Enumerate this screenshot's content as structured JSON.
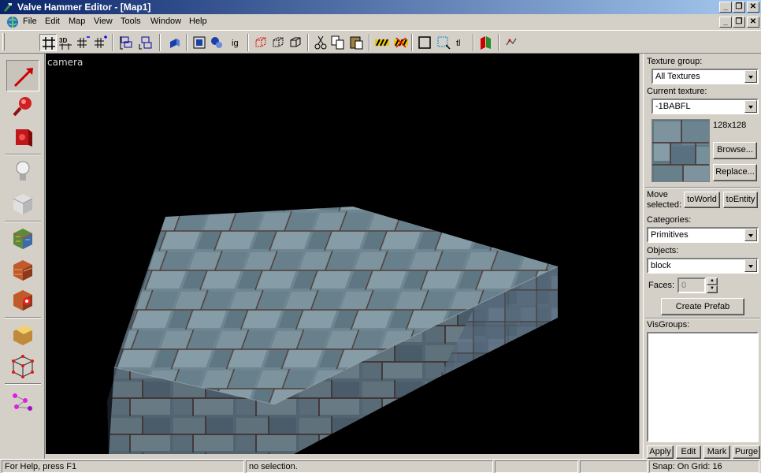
{
  "window": {
    "title": "Valve Hammer Editor - [Map1]"
  },
  "menu": {
    "items": [
      "File",
      "Edit",
      "Map",
      "View",
      "Tools",
      "Window",
      "Help"
    ]
  },
  "toolbar": {
    "buttons": [
      "grid-icon",
      "3d-grid-icon",
      "smaller-grid-icon",
      "larger-grid-icon",
      "group-icon",
      "ungroup-icon",
      "tie-to-entity-icon",
      "carve-icon",
      "hollow-icon",
      "texture-lock-icon",
      "ig-icon",
      "hide-selected-icon",
      "hide-unselected-icon",
      "show-all-icon",
      "cut-icon",
      "copy-icon",
      "paste-icon",
      "toggle-hidden-icon",
      "toggle-cordon-icon",
      "select-box-icon",
      "select-all-icon",
      "tl-icon",
      "run-map-icon",
      "options-icon"
    ],
    "ig_label": "ig",
    "tl_label": "tl"
  },
  "tools": [
    "selection-tool",
    "magnify-tool",
    "camera-tool",
    "entity-tool",
    "block-tool",
    "texture-application-tool",
    "apply-current-texture-tool",
    "decal-tool",
    "clipping-tool",
    "vertex-manipulation-tool",
    "path-tool"
  ],
  "viewport": {
    "label": "camera"
  },
  "right_panel": {
    "texture_group_label": "Texture group:",
    "texture_group_value": "All Textures",
    "current_texture_label": "Current texture:",
    "current_texture_value": "-1BABFL",
    "texture_size": "128x128",
    "browse_label": "Browse...",
    "replace_label": "Replace...",
    "move_selected_label_1": "Move",
    "move_selected_label_2": "selected:",
    "to_world_label": "toWorld",
    "to_entity_label": "toEntity",
    "categories_label": "Categories:",
    "categories_value": "Primitives",
    "objects_label": "Objects:",
    "objects_value": "block",
    "faces_label": "Faces:",
    "faces_value": "0",
    "create_prefab_label": "Create Prefab",
    "visgroups_label": "VisGroups:",
    "apply_label": "Apply",
    "edit_label": "Edit",
    "mark_label": "Mark",
    "purge_label": "Purge"
  },
  "status": {
    "help": "For Help, press F1",
    "selection": "no selection.",
    "snap": "Snap: On Grid: 16"
  },
  "colors": {
    "title_start": "#0a246a",
    "title_end": "#a6caf0",
    "face": "#d4d0c8",
    "viewport_bg": "#000000"
  }
}
